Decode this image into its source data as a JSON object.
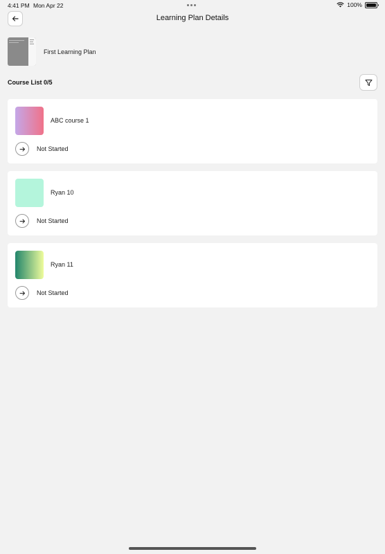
{
  "status_bar": {
    "time": "4:41 PM",
    "date": "Mon Apr 22",
    "battery": "100%"
  },
  "nav": {
    "title": "Learning Plan Details",
    "back_icon": "arrow-left-icon"
  },
  "plan": {
    "name": "First Learning Plan"
  },
  "course_list": {
    "label": "Course List 0/5",
    "filter_icon": "filter-icon"
  },
  "courses": [
    {
      "name": "ABC course 1",
      "status": "Not Started",
      "colors": [
        "#c4a7e8",
        "#f07289"
      ]
    },
    {
      "name": "Ryan 10",
      "status": "Not Started",
      "colors": [
        "#b4f5dc",
        "#b4f5dc"
      ]
    },
    {
      "name": "Ryan 11",
      "status": "Not Started",
      "colors": [
        "#22856b",
        "#eefc9c"
      ]
    }
  ]
}
